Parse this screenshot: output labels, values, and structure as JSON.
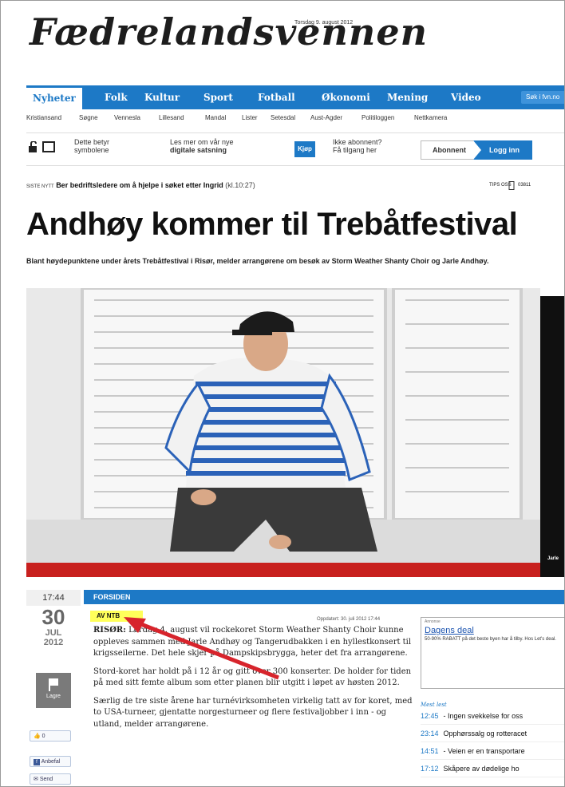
{
  "masthead": {
    "logo": "Fædrelandsvennen",
    "date": "Torsdag 9. august 2012"
  },
  "nav": {
    "items": [
      "Nyheter",
      "Folk",
      "Kultur",
      "Sport",
      "Fotball",
      "Økonomi",
      "Mening",
      "Video"
    ],
    "search_label": "Søk i fvn.no"
  },
  "subnav": [
    "Kristiansand",
    "Søgne",
    "Vennesla",
    "Lillesand",
    "Mandal",
    "Lister",
    "Setesdal",
    "Aust-Agder",
    "Politiloggen",
    "Nettkamera"
  ],
  "promo": {
    "symbols_1": "Dette betyr",
    "symbols_2": "symbolene",
    "digital_1": "Les mer om vår nye",
    "digital_2": "digitale satsning",
    "buy": "Kjøp",
    "access_1": "Ikke abonnent?",
    "access_2": "Få tilgang her",
    "subscriber": "Abonnent",
    "login": "Logg inn"
  },
  "ticker": {
    "label": "SISTE NYTT",
    "text": "Ber bedriftsledere om å hjelpe i søket etter Ingrid",
    "time": "(kl.10:27)",
    "tips": "TIPS OSS",
    "phone": "03811"
  },
  "article": {
    "headline": "Andhøy kommer til Trebåtfestival",
    "lead": "Blant høydepunktene under årets Trebåtfestival i Risør, melder arrangørene om besøk av Storm Weather Shanty Choir og Jarle Andhøy.",
    "photo_caption": "Jarle",
    "section": "FORSIDEN",
    "byline_prefix": "AV:",
    "byline": "AV NTB",
    "updated": "Oppdatert: 30. juli 2012 17:44",
    "dateline": "RISØR:",
    "paragraphs": [
      "Lørdag 4. august vil rockekoret Storm Weather Shanty Choir kunne oppleves sammen med Jarle Andhøy og Tangerudbakken i en hyllestkonsert til krigsseilerne. Det hele skjer på Dampskipsbrygga, heter det fra arrangørene.",
      "Stord-koret har holdt på i 12 år og gitt over 300 konserter. De holder for tiden på med sitt femte album som etter planen blir utgitt i løpet av høsten 2012.",
      "Særlig de tre siste årene har turnévirksomheten virkelig tatt av for koret, med to USA-turneer, gjentatte norgesturneer og flere festivaljobber i inn - og utland, melder arrangørene."
    ]
  },
  "date_block": {
    "time": "17:44",
    "day": "30",
    "month": "JUL",
    "year": "2012"
  },
  "actions": {
    "save": "Lagre",
    "like_count": "0",
    "share": "Anbefal",
    "send": "Send"
  },
  "sidebar": {
    "ad_label": "Annonse",
    "deal_title": "Dagens deal",
    "deal_text": "50-90% RABATT på det beste byen har å tilby. Hos Let's deal.",
    "most_read_label": "Mest lest",
    "most_read": [
      {
        "time": "12:45",
        "title": "- Ingen svekkelse for oss"
      },
      {
        "time": "23:14",
        "title": "Opphørssalg og rotteracet"
      },
      {
        "time": "14:51",
        "title": "- Veien er en transportare"
      },
      {
        "time": "17:12",
        "title": "Skåpere av dødelige ho"
      }
    ]
  },
  "colors": {
    "brand_blue": "#1d79c6",
    "highlight": "#ffff5a",
    "annotation_arrow": "#d7242c"
  }
}
